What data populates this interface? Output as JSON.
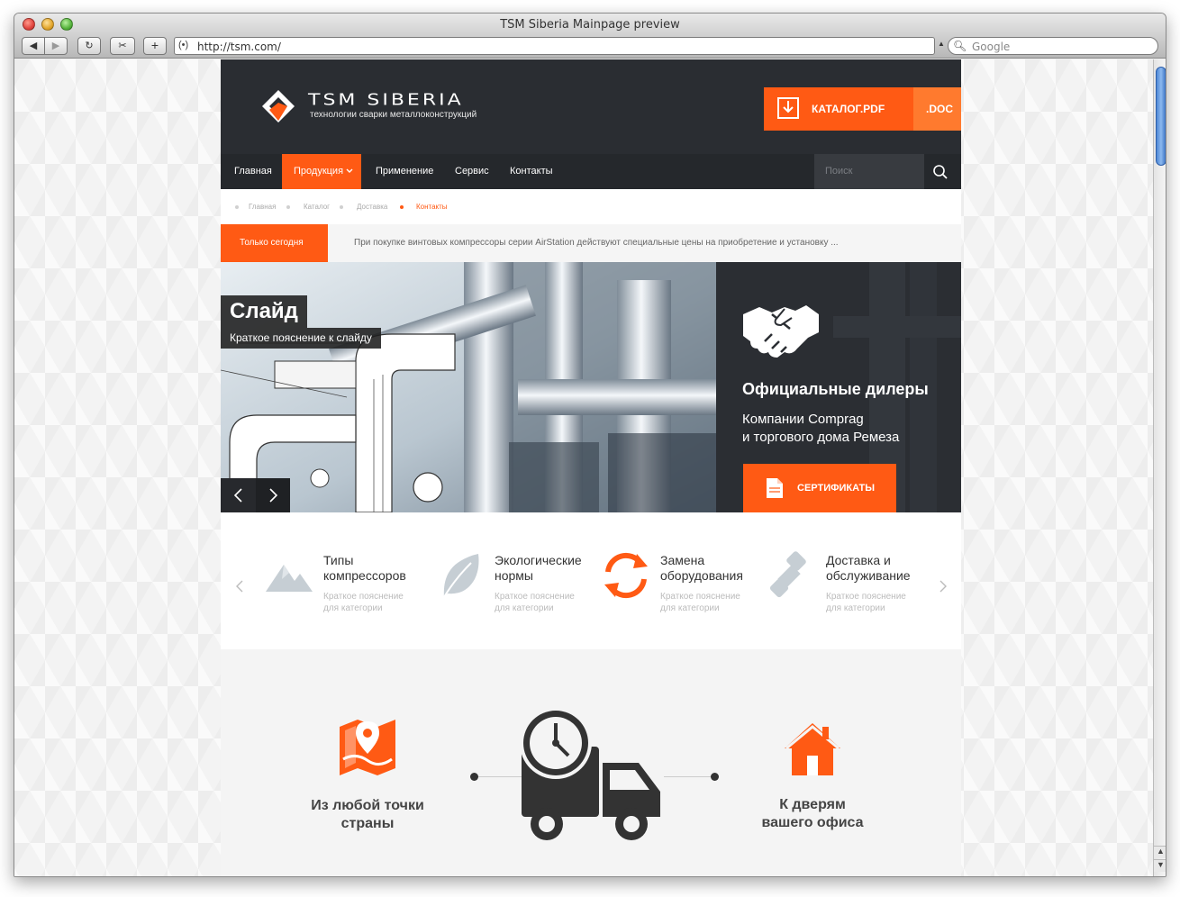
{
  "browser": {
    "window_title": "TSM Siberia Mainpage preview",
    "url": "http://tsm.com/",
    "search_placeholder": "Google"
  },
  "site": {
    "logo": {
      "name": "TSM SIBERIA",
      "tagline": "технологии сварки металлоконструкций"
    },
    "header": {
      "catalog_pdf_label": "КАТАЛОГ.PDF",
      "catalog_doc_label": ".DOC"
    },
    "nav": {
      "items": [
        "Главная",
        "Продукция",
        "Применение",
        "Сервис",
        "Контакты"
      ],
      "active_index": 1,
      "search_placeholder": "Поиск"
    },
    "breadcrumbs": [
      "Главная",
      "Каталог",
      "Доставка",
      "Контакты"
    ],
    "promo": {
      "tag": "Только сегодня",
      "text": "При покупке винтовых компрессоры серии AirStation действуют специальные цены на приобретение и установку ..."
    },
    "slider": {
      "title": "Слайд",
      "subtitle": "Краткое пояснение к слайду"
    },
    "dealers": {
      "title": "Официальные дилеры",
      "text_line1": "Компании Comprag",
      "text_line2": "и торгового дома Ремеза",
      "button_label": "СЕРТИФИКАТЫ"
    },
    "categories": [
      {
        "icon": "mountains-icon",
        "title_line1": "Типы",
        "title_line2": "компрессоров",
        "desc_line1": "Краткое пояснение",
        "desc_line2": "для категории"
      },
      {
        "icon": "leaf-icon",
        "title_line1": "Экологические",
        "title_line2": "нормы",
        "desc_line1": "Краткое пояснение",
        "desc_line2": "для категории"
      },
      {
        "icon": "refresh-icon",
        "title_line1": "Замена",
        "title_line2": "оборудования",
        "desc_line1": "Краткое пояснение",
        "desc_line2": "для категории"
      },
      {
        "icon": "wrench-icon",
        "title_line1": "Доставка и",
        "title_line2": "обслуживание",
        "desc_line1": "Краткое пояснение",
        "desc_line2": "для категории"
      }
    ],
    "delivery": {
      "from_line1": "Из любой точки",
      "from_line2": "страны",
      "to_line1": "К дверям",
      "to_line2": "вашего офиса"
    },
    "colors": {
      "accent": "#ff5a14",
      "header_bg": "#2a2d32",
      "nav_bg": "#25282c",
      "text_dark": "#444444"
    }
  }
}
